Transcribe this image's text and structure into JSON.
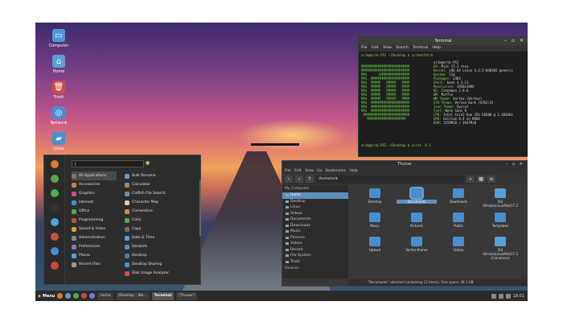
{
  "desktop": {
    "icons": [
      {
        "label": "Computer",
        "icon": "monitor-icon",
        "color": "#4e9ad8"
      },
      {
        "label": "Home",
        "icon": "home-folder-icon",
        "color": "#5e9fd6"
      },
      {
        "label": "Trash",
        "icon": "trash-icon",
        "color": "#c94c4c"
      },
      {
        "label": "Network",
        "icon": "network-icon",
        "color": "#4a8ed0"
      },
      {
        "label": "Linux",
        "icon": "folder-icon",
        "color": "#4a8ed0"
      }
    ]
  },
  "terminal": {
    "title": "Terminal",
    "menu": "File Edit View Search Terminal Help",
    "prompt_top": "erik@erik-PSI ~/Desktop $ screenfetch",
    "prompt_bottom": "erik@erik-PSI ~/Desktop $ scrot -d 2",
    "info": [
      {
        "k": "",
        "v": "erik@erik-PSI"
      },
      {
        "k": "OS:",
        "v": "Mint 17.3 rosa"
      },
      {
        "k": "Kernel:",
        "v": "x86_64 Linux 4.3.5-040305-generic"
      },
      {
        "k": "Uptime:",
        "v": "21m"
      },
      {
        "k": "Packages:",
        "v": "2383"
      },
      {
        "k": "Shell:",
        "v": "bash 4.3.11"
      },
      {
        "k": "Resolution:",
        "v": "1920x1080"
      },
      {
        "k": "DE:",
        "v": "Cinnamon 2.8.6"
      },
      {
        "k": "WM:",
        "v": "Muffin"
      },
      {
        "k": "WM Theme:",
        "v": "Vertex (Vertex)"
      },
      {
        "k": "GTK Theme:",
        "v": "Vertex-Dark [GTK2/3]"
      },
      {
        "k": "Icon Theme:",
        "v": "Sycrul"
      },
      {
        "k": "Font:",
        "v": "Noto Sans 9"
      },
      {
        "k": "CPU:",
        "v": "Intel Core2 Duo CPU E6600 @ 2.403GHz"
      },
      {
        "k": "GPU:",
        "v": "Gallium 0.4 on NV84"
      },
      {
        "k": "RAM:",
        "v": "1559MiB / 3947MiB"
      }
    ]
  },
  "menu": {
    "search_value": "|",
    "categories": [
      {
        "label": "All Applications",
        "color": "#777777"
      },
      {
        "label": "Accessories",
        "color": "#d97b3f"
      },
      {
        "label": "Graphics",
        "color": "#c94f8a"
      },
      {
        "label": "Internet",
        "color": "#4a8ed0"
      },
      {
        "label": "Office",
        "color": "#5aa55a"
      },
      {
        "label": "Programming",
        "color": "#c94c4c"
      },
      {
        "label": "Sound & Video",
        "color": "#d8a030"
      },
      {
        "label": "Administration",
        "color": "#888888"
      },
      {
        "label": "Preferences",
        "color": "#7a7ad0"
      },
      {
        "label": "Places",
        "color": "#5aa0d8"
      },
      {
        "label": "Recent Files",
        "color": "#999999"
      }
    ],
    "apps": [
      {
        "label": "Bulk Rename",
        "color": "#5aa0d8"
      },
      {
        "label": "Calculator",
        "color": "#888888"
      },
      {
        "label": "Catfish File Search",
        "color": "#6b8fb0"
      },
      {
        "label": "Character Map",
        "color": "#cccccc"
      },
      {
        "label": "Clementine",
        "color": "#e08a3a"
      },
      {
        "label": "Color",
        "color": "#5aa55a"
      },
      {
        "label": "Copy",
        "color": "#6e6e6e"
      },
      {
        "label": "Date & Time",
        "color": "#5aa0d8"
      },
      {
        "label": "Desklets",
        "color": "#4a8ed0"
      },
      {
        "label": "Desktop",
        "color": "#4a7ab0"
      },
      {
        "label": "Desktop Sharing",
        "color": "#4a8ed0"
      },
      {
        "label": "Disk Usage Analyzer",
        "color": "#c94c4c"
      }
    ],
    "side_buttons": [
      {
        "icon": "firefox-icon",
        "color": "#e07a2a"
      },
      {
        "icon": "settings-icon",
        "color": "#5aa55a"
      },
      {
        "icon": "software-icon",
        "color": "#4caf50"
      },
      {
        "icon": "terminal-icon",
        "color": "#333333"
      },
      {
        "icon": "folder-icon",
        "color": "#5aa0d8"
      },
      {
        "icon": "lock-icon",
        "color": "#c94c4c"
      },
      {
        "icon": "logout-icon",
        "color": "#4a8ed0"
      },
      {
        "icon": "power-icon",
        "color": "#d0453a"
      }
    ]
  },
  "files": {
    "title": "Thunar",
    "menu": "File Edit View Go Bookmarks Help",
    "path": "/home/erik",
    "sidebar_header": "My Computer",
    "sidebar_items": [
      "Home",
      "Desktop",
      "Linux",
      "Videos",
      "Documents",
      "Downloads",
      "Music",
      "Pictures",
      "Videos",
      "Recent",
      "File System",
      "Trash"
    ],
    "devices_header": "Devices",
    "grid": [
      "Desktop",
      "Documents",
      "Downloads",
      "ISS UltraIsoLinuxMint17.3",
      "Music",
      "Pictures",
      "Public",
      "Templates",
      "Upload",
      "Vertex-theme",
      "Videos",
      "ISS UltraIsoLinuxMint17.3 (Cinnamon)"
    ],
    "status": "\"Documents\" selected (containing 12 items), Free space: 29.1 GB"
  },
  "taskbar": {
    "menu_label": "Menu",
    "windows": [
      "Home",
      "[Desktop - Wo...",
      "Terminal",
      "[Thunar]"
    ],
    "active_index": 2,
    "clock": "19:01"
  }
}
